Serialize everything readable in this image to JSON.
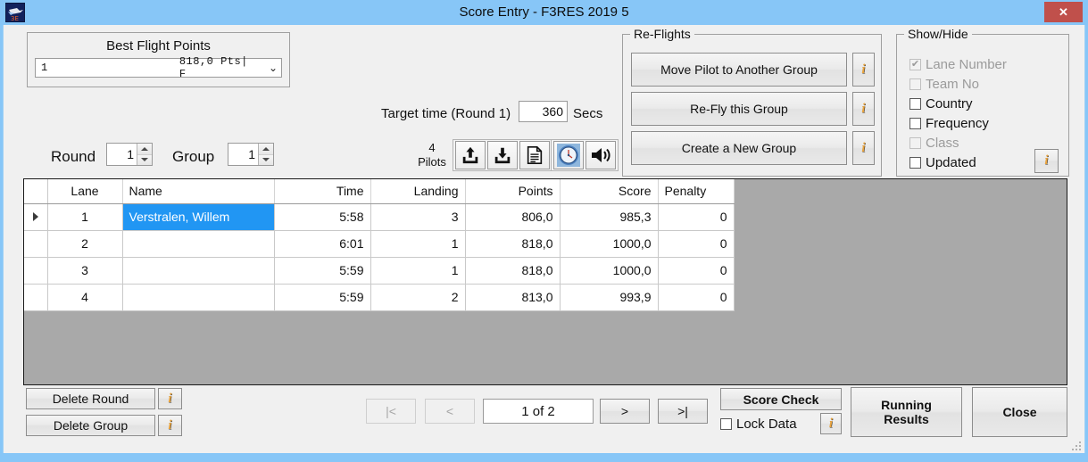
{
  "window": {
    "title": "Score Entry - F3RES 2019 5",
    "app_icon": "glider-icon",
    "close_label": "✕",
    "titlebar_color": "#87c6f7",
    "close_button_color": "#c0504b"
  },
  "best_flight_points": {
    "group_title": "Best Flight Points",
    "rank": "1",
    "name_redacted": "",
    "points": "818,0 Pts| F",
    "chevron": "⌄"
  },
  "round_group": {
    "round_label": "Round",
    "round_value": "1",
    "group_label": "Group",
    "group_value": "1"
  },
  "target_time": {
    "label": "Target time (Round 1)",
    "value": "360",
    "units": "Secs"
  },
  "pilots": {
    "count": "4",
    "label": "Pilots"
  },
  "toolbar": {
    "buttons": [
      {
        "name": "upload-icon",
        "title": "Upload"
      },
      {
        "name": "download-icon",
        "title": "Download"
      },
      {
        "name": "document-icon",
        "title": "Document"
      },
      {
        "name": "clock-icon",
        "title": "Timer"
      },
      {
        "name": "speaker-icon",
        "title": "Sound"
      }
    ]
  },
  "reflights": {
    "group_title": "Re-Flights",
    "buttons": [
      {
        "label": "Move Pilot to Another Group",
        "info": "i"
      },
      {
        "label": "Re-Fly this Group",
        "info": "i"
      },
      {
        "label": "Create a New Group",
        "info": "i"
      }
    ]
  },
  "showhide": {
    "group_title": "Show/Hide",
    "info": "i",
    "items": [
      {
        "label": "Lane Number",
        "checked": true,
        "enabled": false,
        "mark": "✔"
      },
      {
        "label": "Team No",
        "checked": false,
        "enabled": false,
        "mark": ""
      },
      {
        "label": "Country",
        "checked": false,
        "enabled": true,
        "mark": ""
      },
      {
        "label": "Frequency",
        "checked": false,
        "enabled": true,
        "mark": ""
      },
      {
        "label": "Class",
        "checked": false,
        "enabled": false,
        "mark": ""
      },
      {
        "label": "Updated",
        "checked": false,
        "enabled": true,
        "mark": ""
      }
    ]
  },
  "grid": {
    "columns": [
      "Lane",
      "Name",
      "Time",
      "Landing",
      "Points",
      "Score",
      "Penalty"
    ],
    "selected_cell": {
      "row": 0,
      "column": "Name"
    },
    "selection_color": "#2196f3",
    "rows": [
      {
        "current": true,
        "lane": "1",
        "name": "Verstralen, Willem",
        "time": "5:58",
        "landing": "3",
        "points": "806,0",
        "score": "985,3",
        "penalty": "0"
      },
      {
        "current": false,
        "lane": "2",
        "name": "",
        "time": "6:01",
        "landing": "1",
        "points": "818,0",
        "score": "1000,0",
        "penalty": "0"
      },
      {
        "current": false,
        "lane": "3",
        "name": "",
        "time": "5:59",
        "landing": "1",
        "points": "818,0",
        "score": "1000,0",
        "penalty": "0"
      },
      {
        "current": false,
        "lane": "4",
        "name": "",
        "time": "5:59",
        "landing": "2",
        "points": "813,0",
        "score": "993,9",
        "penalty": "0"
      }
    ]
  },
  "footer": {
    "delete_round": "Delete Round",
    "delete_round_info": "i",
    "delete_group": "Delete Group",
    "delete_group_info": "i",
    "nav": {
      "first": "|<",
      "prev": "<",
      "position": "1 of 2",
      "next": ">",
      "last": ">|",
      "first_enabled": false,
      "prev_enabled": false,
      "next_enabled": true,
      "last_enabled": true
    },
    "score_check": "Score Check",
    "lock_data": "Lock Data",
    "lock_data_checked": false,
    "lock_data_info": "i",
    "running_results_line1": "Running",
    "running_results_line2": "Results",
    "close": "Close"
  }
}
